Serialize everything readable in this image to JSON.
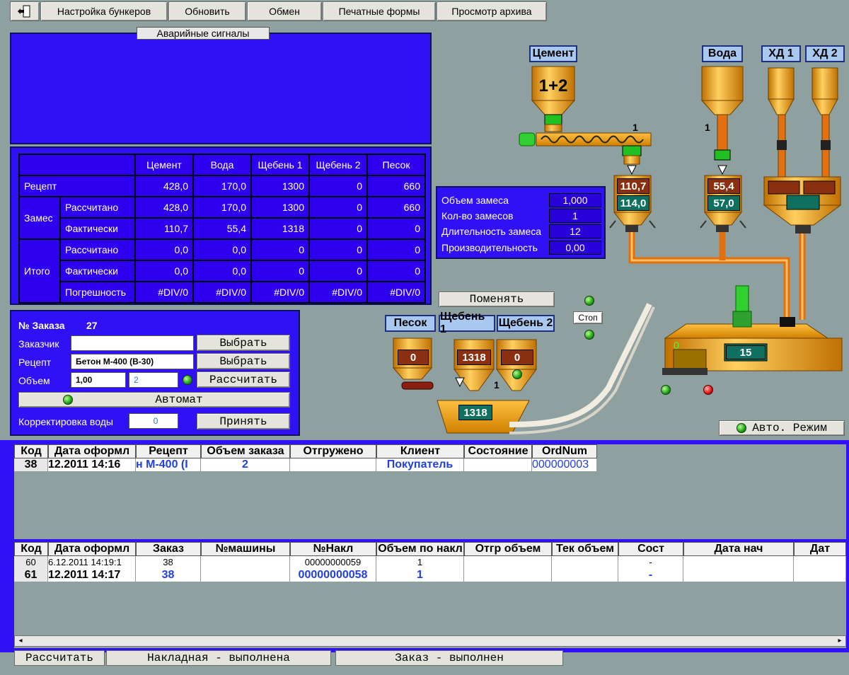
{
  "toolbar": {
    "exit_icon": "exit-door-icon",
    "items": [
      "Настройка бункеров",
      "Обновить",
      "Обмен",
      "Печатные формы",
      "Просмотр архива"
    ]
  },
  "alarms": {
    "title": "Аварийные сигналы"
  },
  "recipe_table": {
    "columns": [
      "Цемент",
      "Вода",
      "Щебень 1",
      "Щебень 2",
      "Песок"
    ],
    "recipe_label": "Рецепт",
    "recipe": [
      "428,0",
      "170,0",
      "1300",
      "0",
      "660"
    ],
    "batch_label": "Замес",
    "calc_label": "Рассчитано",
    "fact_label": "Фактически",
    "error_label": "Погрешность",
    "batch_calc": [
      "428,0",
      "170,0",
      "1300",
      "0",
      "660"
    ],
    "batch_fact": [
      "110,7",
      "55,4",
      "1318",
      "0",
      "0"
    ],
    "total_label": "Итого",
    "total_calc": [
      "0,0",
      "0,0",
      "0",
      "0",
      "0"
    ],
    "total_fact": [
      "0,0",
      "0,0",
      "0",
      "0",
      "0"
    ],
    "total_error": [
      "#DIV/0",
      "#DIV/0",
      "#DIV/0",
      "#DIV/0",
      "#DIV/0"
    ]
  },
  "order": {
    "number_label": "№ Заказа",
    "number": "27",
    "customer_label": "Заказчик",
    "customer_value": "",
    "recipe_label": "Рецепт",
    "recipe_value": "Бетон М-400 (В-30)",
    "volume_label": "Объем",
    "volume_value": "1,00",
    "volume_hint": "2",
    "select_label": "Выбрать",
    "calc_button": "Рассчитать",
    "auto_button": "Автомат",
    "water_label": "Корректировка воды",
    "water_value": "0",
    "accept_button": "Принять"
  },
  "batch_params": {
    "volume_label": "Объем замеса",
    "volume": "1,000",
    "count_label": "Кол-во замесов",
    "count": "1",
    "duration_label": "Длительность замеса",
    "duration": "12",
    "productivity_label": "Производительность",
    "productivity": "0,00"
  },
  "mimic": {
    "cement_tag": "Цемент",
    "cement_silo": "1+2",
    "water_tag": "Вода",
    "hd1_tag": "ХД 1",
    "hd2_tag": "ХД 2",
    "screw_num": "1",
    "water_num": "1",
    "cement_weigh_top": "110,7",
    "cement_weigh_bottom": "114,0",
    "water_weigh_top": "55,4",
    "water_weigh_bottom": "57,0",
    "swap_button": "Поменять",
    "stop_button": "Стоп",
    "sand_tag": "Песок",
    "gravel1_tag": "Щебень 1",
    "gravel2_tag": "Щебень 2",
    "sand_value": "0",
    "gravel1_value": "1318",
    "gravel2_value": "0",
    "gravel_num": "1",
    "scale_value": "1318",
    "mixer_value": "15",
    "mixer_small": "0",
    "auto_mode": "Авто. Режим"
  },
  "orders_grid": {
    "headers": [
      "Код",
      "Дата оформл",
      "Рецепт",
      "Объем заказа",
      "Отгружено",
      "Клиент",
      "Состояние",
      "OrdNum"
    ],
    "row": [
      "38",
      "12.2011 14:16",
      "н М-400 (I",
      "2",
      "",
      "Покупатель",
      "",
      "000000003"
    ]
  },
  "invoices_grid": {
    "headers": [
      "Код",
      "Дата оформл",
      "Заказ",
      "№машины",
      "№Накл",
      "Объем по накл",
      "Отгр объем",
      "Тек объем",
      "Сост",
      "Дата нач",
      "Дат"
    ],
    "rows": [
      [
        "60",
        "6.12.2011 14:19:1",
        "38",
        "",
        "00000000059",
        "1",
        "",
        "",
        "-",
        "",
        ""
      ],
      [
        "61",
        "12.2011 14:17",
        "38",
        "",
        "00000000058",
        "1",
        "",
        "",
        "-",
        "",
        ""
      ]
    ]
  },
  "status_bar": [
    "Рассчитать",
    "Накладная - выполнена",
    "Заказ - выполнен"
  ],
  "colors": {
    "panel": "#3010f5",
    "orange": "#f0a020",
    "display_red": "#8a3010",
    "display_green": "#107060",
    "highlight_text": "#2040e0"
  }
}
